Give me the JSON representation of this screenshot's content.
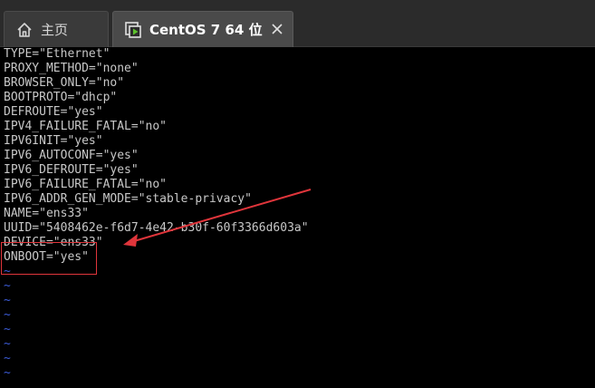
{
  "tabs": [
    {
      "label": "主页",
      "icon": "home-icon"
    },
    {
      "label": "CentOS 7 64 位",
      "icon": "vm-icon"
    }
  ],
  "terminal": {
    "lines": [
      "TYPE=\"Ethernet\"",
      "PROXY_METHOD=\"none\"",
      "BROWSER_ONLY=\"no\"",
      "BOOTPROTO=\"dhcp\"",
      "DEFROUTE=\"yes\"",
      "IPV4_FAILURE_FATAL=\"no\"",
      "IPV6INIT=\"yes\"",
      "IPV6_AUTOCONF=\"yes\"",
      "IPV6_DEFROUTE=\"yes\"",
      "IPV6_FAILURE_FATAL=\"no\"",
      "IPV6_ADDR_GEN_MODE=\"stable-privacy\"",
      "NAME=\"ens33\"",
      "UUID=\"5408462e-f6d7-4e42-b30f-60f3366d603a\"",
      "DEVICE=\"ens33\"",
      "ONBOOT=\"yes\""
    ],
    "tilde": "~"
  },
  "colors": {
    "background": "#000000",
    "text": "#c8c8c8",
    "tilde": "#3b5bd6",
    "annotation": "#e0353b"
  }
}
